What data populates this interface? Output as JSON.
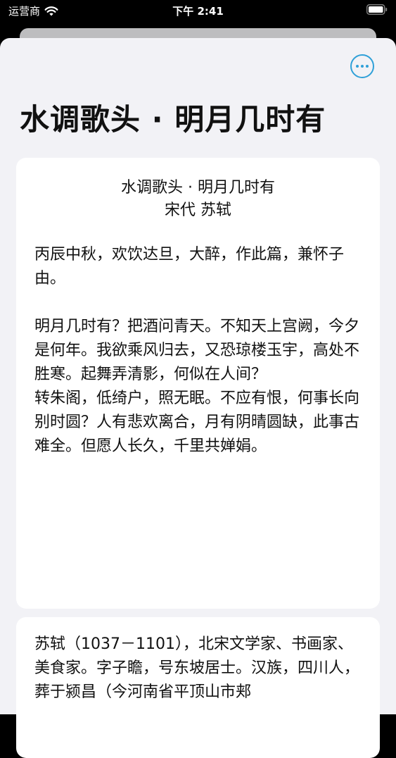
{
  "status_bar": {
    "carrier": "运营商",
    "time": "下午 2:41"
  },
  "header": {
    "title": "水调歌头 · 明月几时有"
  },
  "poem": {
    "title": "水调歌头 · 明月几时有",
    "author_line": "宋代 苏轼",
    "preface": "丙辰中秋，欢饮达旦，大醉，作此篇，兼怀子由。",
    "stanza1": "明月几时有？把酒问青天。不知天上宫阙，今夕是何年。我欲乘风归去，又恐琼楼玉宇，高处不胜寒。起舞弄清影，何似在人间？",
    "stanza2": "转朱阁，低绮户，照无眠。不应有恨，何事长向别时圆？人有悲欢离合，月有阴晴圆缺，此事古难全。但愿人长久，千里共婵娟。"
  },
  "bio": {
    "text": "苏轼（1037－1101），北宋文学家、书画家、美食家。字子瞻，号东坡居士。汉族，四川人，葬于颍昌（今河南省平顶山市郏"
  },
  "colors": {
    "accent": "#2fa0d8",
    "background": "#f2f2f6",
    "card": "#ffffff"
  },
  "icons": {
    "more": "more-icon",
    "wifi": "wifi-icon",
    "battery": "battery-icon"
  }
}
